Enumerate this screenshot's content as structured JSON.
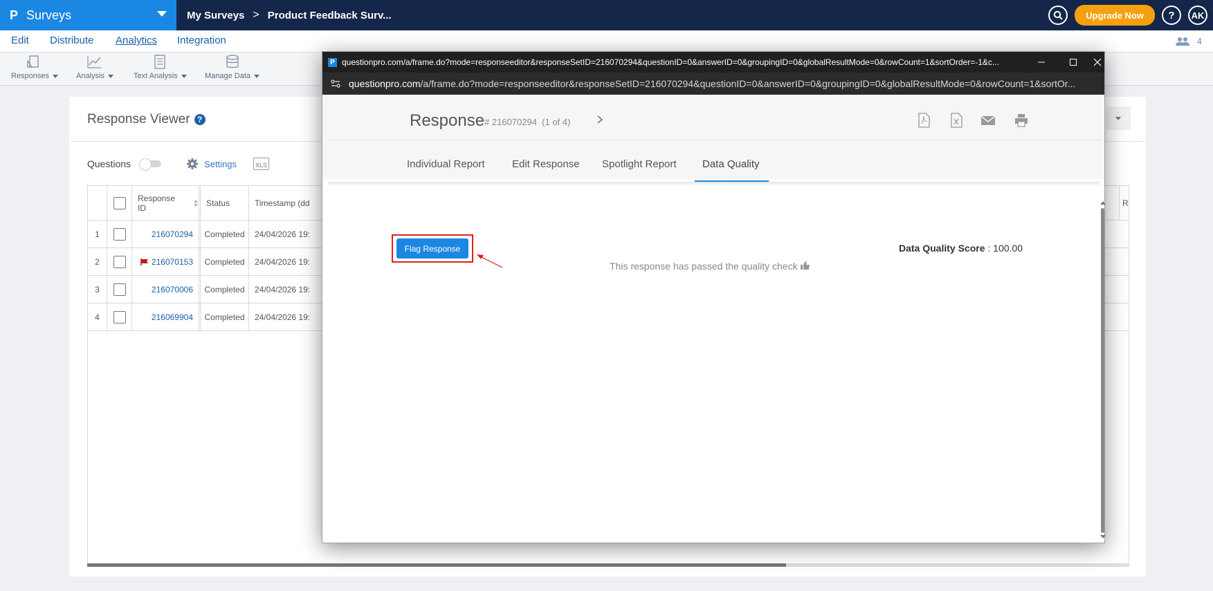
{
  "topbar": {
    "brand": "Surveys",
    "breadcrumb": [
      "My Surveys",
      "Product Feedback Surv..."
    ],
    "upgrade_label": "Upgrade Now",
    "help_label": "?",
    "avatar_initials": "AK"
  },
  "menu": {
    "items": [
      "Edit",
      "Distribute",
      "Analytics",
      "Integration"
    ],
    "active": "Analytics",
    "users_count": "4"
  },
  "toolbar": {
    "tools": [
      "Responses",
      "Analysis",
      "Text Analysis",
      "Manage Data"
    ]
  },
  "viewer": {
    "title": "Response Viewer",
    "questions_label": "Questions",
    "settings_label": "Settings",
    "xls_label": "XLS",
    "table": {
      "headers": [
        "Response ID",
        "Status",
        "Timestamp (dd"
      ],
      "rows": [
        {
          "n": "1",
          "id": "216070294",
          "status": "Completed",
          "ts": "24/04/2026 19:",
          "flagged": false
        },
        {
          "n": "2",
          "id": "216070153",
          "status": "Completed",
          "ts": "24/04/2026 19:",
          "flagged": true
        },
        {
          "n": "3",
          "id": "216070006",
          "status": "Completed",
          "ts": "24/04/2026 19:",
          "flagged": false
        },
        {
          "n": "4",
          "id": "216069904",
          "status": "Completed",
          "ts": "24/04/2026 19:",
          "flagged": false
        }
      ],
      "trailing_header": "R"
    }
  },
  "popup": {
    "window_title": "questionpro.com/a/frame.do?mode=responseeditor&responseSetID=216070294&questionID=0&answerID=0&groupingID=0&globalResultMode=0&rowCount=1&sortOrder=-1&c...",
    "url_host": "questionpro.com",
    "url_path": "/a/frame.do?mode=responseeditor&responseSetID=216070294&questionID=0&answerID=0&groupingID=0&globalResultMode=0&rowCount=1&sortOr...",
    "response_title": "Response",
    "response_id": "# 216070294",
    "response_pos": "(1 of 4)",
    "tabs": [
      "Individual Report",
      "Edit Response",
      "Spotlight Report",
      "Data Quality"
    ],
    "active_tab": "Data Quality",
    "flag_button": "Flag Response",
    "score_label": "Data Quality Score",
    "score_value": ": 100.00",
    "quality_message": "This response has passed the quality check"
  },
  "colors": {
    "brand_blue": "#1a87e2",
    "navy": "#14264a",
    "upgrade_orange": "#f5a00f",
    "annotation_red": "#e02020"
  }
}
